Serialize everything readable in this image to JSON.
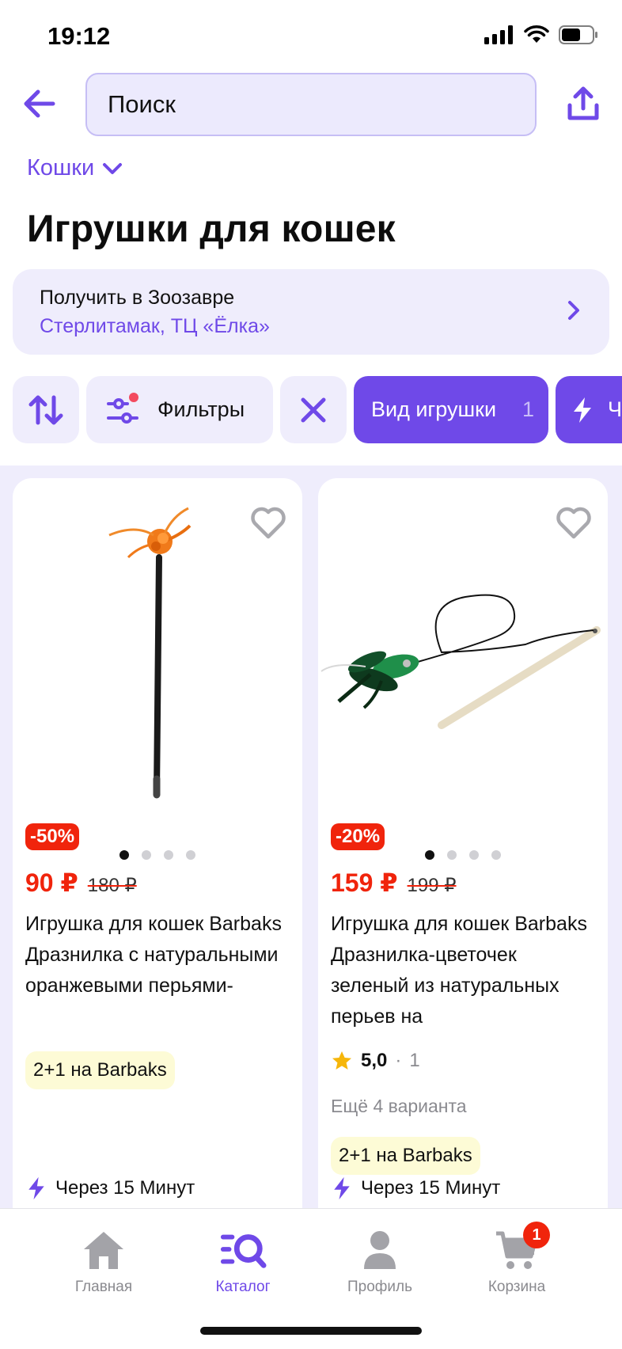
{
  "status_bar": {
    "time": "19:12"
  },
  "search": {
    "placeholder": "Поиск"
  },
  "breadcrumb": {
    "label": "Кошки"
  },
  "page": {
    "title": "Игрушки для кошек"
  },
  "pickup": {
    "title": "Получить в Зоозавре",
    "address": "Стерлитамак, ТЦ «Ёлка»"
  },
  "filters": {
    "filters_label": "Фильтры",
    "toy_type_label": "Вид игрушки",
    "toy_type_count": "1",
    "fast_label": "Че"
  },
  "products": [
    {
      "discount": "-50%",
      "price": "90 ₽",
      "old_price": "180 ₽",
      "title": "Игрушка для кошек Barbaks Дразнилка с натуральными оранжевыми перьями-",
      "promo": "2+1 на Barbaks",
      "delivery": "Через 15 Минут"
    },
    {
      "discount": "-20%",
      "price": "159 ₽",
      "old_price": "199 ₽",
      "title": "Игрушка для кошек Barbaks Дразнилка-цветочек зеленый из натуральных перьев на",
      "rating": "5,0",
      "reviews": "1",
      "variants": "Ещё 4 варианта",
      "promo": "2+1 на Barbaks",
      "delivery": "Через 15 Минут"
    }
  ],
  "tabs": [
    {
      "label": "Главная",
      "icon": "home-icon"
    },
    {
      "label": "Каталог",
      "icon": "catalog-icon"
    },
    {
      "label": "Профиль",
      "icon": "profile-icon"
    },
    {
      "label": "Корзина",
      "icon": "cart-icon",
      "badge": "1"
    }
  ],
  "colors": {
    "accent": "#6f49e8",
    "sale": "#f0240c",
    "surface": "#efedfc"
  }
}
